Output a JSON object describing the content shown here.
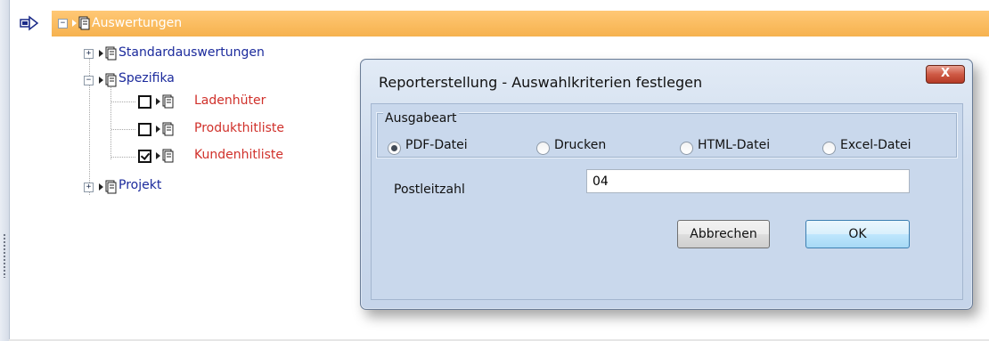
{
  "tree": {
    "root_label": "Auswertungen",
    "items": [
      {
        "label": "Standardauswertungen",
        "expander": "+"
      },
      {
        "label": "Spezifika",
        "expander": "−"
      },
      {
        "label": "Ladenhüter",
        "checked": false
      },
      {
        "label": "Produkthitliste",
        "checked": false
      },
      {
        "label": "Kundenhitliste",
        "checked": true
      },
      {
        "label": "Projekt",
        "expander": "+"
      }
    ],
    "root_expander": "−"
  },
  "dialog": {
    "title": "Reporterstellung - Auswahlkriterien festlegen",
    "close_label": "X",
    "group_label": "Ausgabeart",
    "radios": [
      {
        "label": "PDF-Datei",
        "selected": true
      },
      {
        "label": "Drucken",
        "selected": false
      },
      {
        "label": "HTML-Datei",
        "selected": false
      },
      {
        "label": "Excel-Datei",
        "selected": false
      }
    ],
    "postleitzahl_label": "Postleitzahl",
    "postleitzahl_value": "04",
    "cancel_label": "Abbrechen",
    "ok_label": "OK"
  },
  "colors": {
    "selection": "#f6b24f",
    "tree_text": "#1b2a9c",
    "report_text": "#d0302a"
  }
}
